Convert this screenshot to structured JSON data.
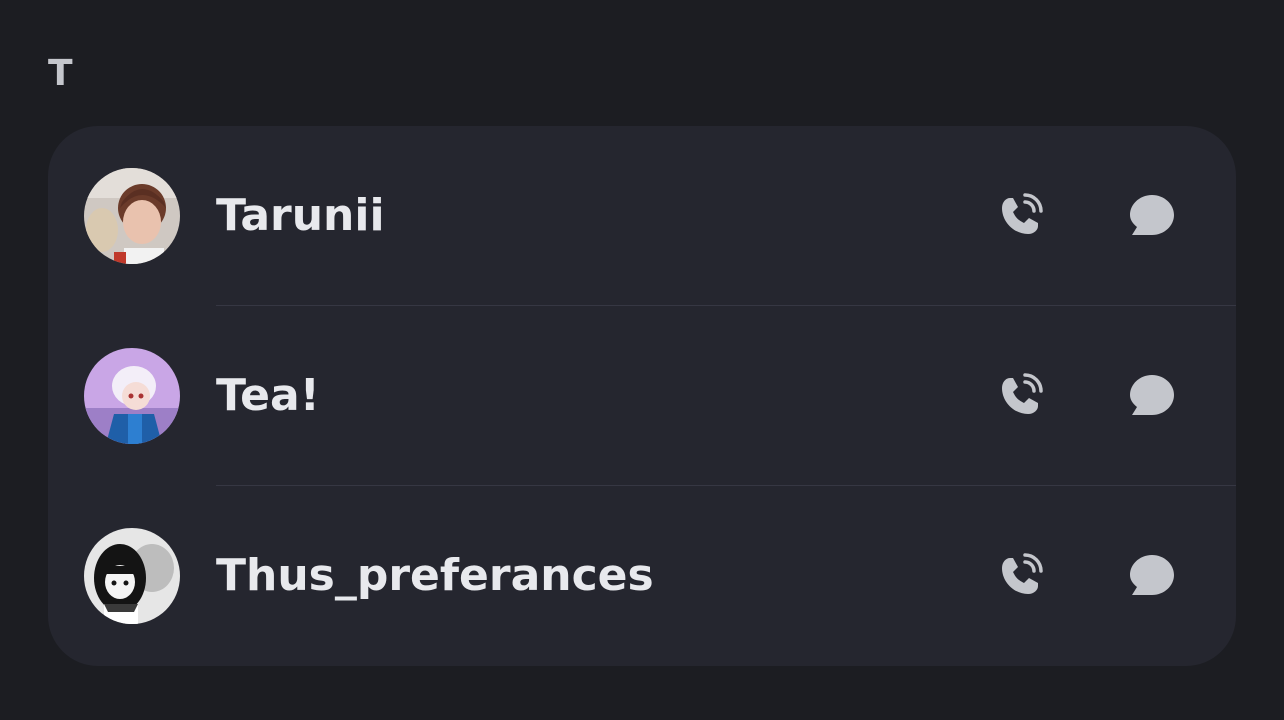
{
  "section": {
    "letter": "T"
  },
  "contacts": [
    {
      "name": "Tarunii",
      "avatar_icon": "avatar-photo",
      "call_icon": "phone-call-icon",
      "message_icon": "chat-bubble-icon"
    },
    {
      "name": "Tea!",
      "avatar_icon": "avatar-anime",
      "call_icon": "phone-call-icon",
      "message_icon": "chat-bubble-icon"
    },
    {
      "name": "Thus_preferances",
      "avatar_icon": "avatar-manga",
      "call_icon": "phone-call-icon",
      "message_icon": "chat-bubble-icon"
    }
  ],
  "colors": {
    "background": "#1c1d22",
    "card": "#25262f",
    "text": "#e8e9ed",
    "icon": "#c4c6cc",
    "divider": "#363743"
  }
}
